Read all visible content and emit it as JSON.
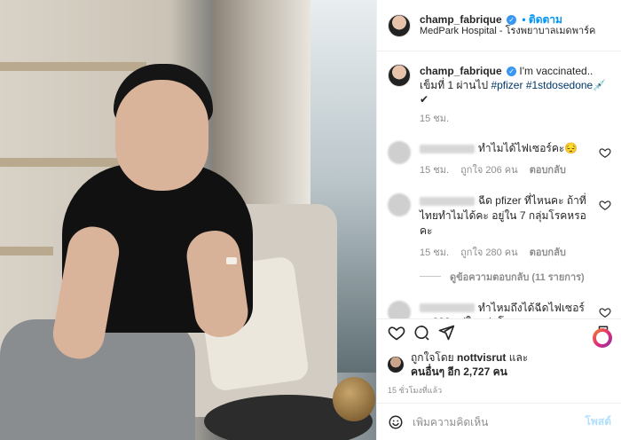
{
  "post": {
    "username": "champ_fabrique",
    "follow_label": "• ติดตาม",
    "location": "MedPark Hospital - โรงพยาบาลเมดพาร์ค"
  },
  "caption": {
    "username": "champ_fabrique",
    "text": "I'm vaccinated..",
    "line2_prefix": "เข็มที่ 1 ผ่านไป ",
    "tag1": "#pfizer",
    "tag2": "#1stdosedone",
    "suffix": "💉✔",
    "time": "15 ชม."
  },
  "comments": [
    {
      "text": "ทำไมได้ไฟเซอร์คะ😔",
      "time": "15 ชม.",
      "likes": "ถูกใจ 206 คน",
      "reply": "ตอบกลับ"
    },
    {
      "text": "ฉีด pfizer ที่ไหนคะ ถ้าที่ไทยทำไมได้คะ อยู่ใน 7 กลุ่มโรคหรอคะ",
      "time": "15 ชม.",
      "likes": "ถูกใจ 280 คน",
      "reply": "ตอบกลับ",
      "view_replies": "ดูข้อความตอบกลับ (11 รายการ)"
    },
    {
      "text": "ทำไหมถึงได้ฉีดไฟเซอร์คะ??? อยู่ในกลุ่มโรคหรอ"
    }
  ],
  "likes": {
    "prefix": "ถูกใจโดย ",
    "user": "nottvisrut",
    "mid": " และ",
    "others": "คนอื่นๆ อีก 2,727 คน"
  },
  "post_time": "15 ชั่วโมงที่แล้ว",
  "comment_box": {
    "placeholder": "เพิ่มความคิดเห็น",
    "post_label": "โพสต์"
  }
}
